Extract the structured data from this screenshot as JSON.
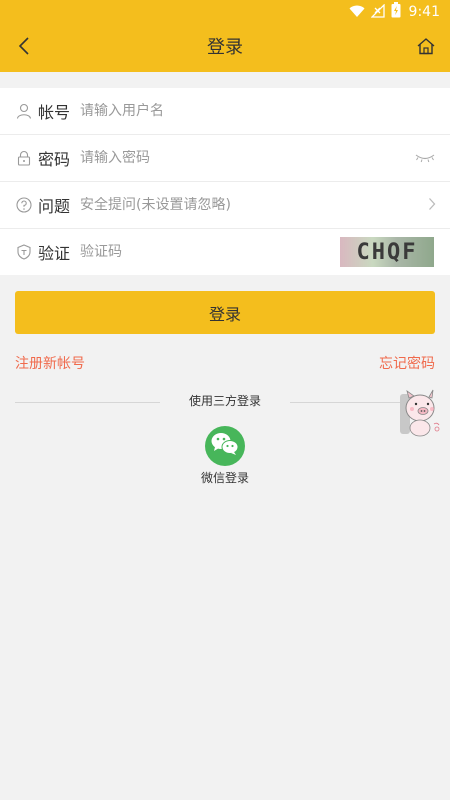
{
  "status": {
    "time": "9:41"
  },
  "header": {
    "title": "登录"
  },
  "form": {
    "account": {
      "label": "帐号",
      "placeholder": "请输入用户名"
    },
    "password": {
      "label": "密码",
      "placeholder": "请输入密码"
    },
    "question": {
      "label": "问题",
      "placeholder": "安全提问(未设置请忽略)"
    },
    "captcha": {
      "label": "验证",
      "placeholder": "验证码",
      "code": "CHQF"
    }
  },
  "actions": {
    "login": "登录",
    "register": "注册新帐号",
    "forgot": "忘记密码"
  },
  "third_party": {
    "title": "使用三方登录",
    "wechat": "微信登录"
  },
  "colors": {
    "brand": "#f4be1d",
    "link": "#f06a4c",
    "wechat": "#47b65a"
  }
}
